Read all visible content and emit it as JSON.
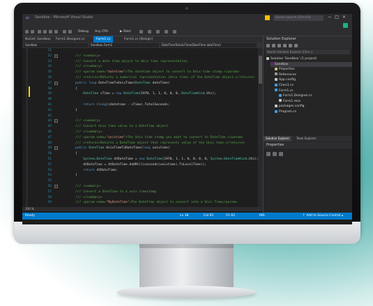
{
  "window": {
    "title": "Sandbox - Microsoft Visual Studio",
    "quick_launch_placeholder": "Quick Launch (Ctrl+Q)",
    "window_controls": [
      "−",
      "□",
      "×"
    ]
  },
  "menu": [
    "File",
    "Edit",
    "View",
    "Project",
    "Build",
    "Debug",
    "Team",
    "Tools",
    "Test",
    "Analyze",
    "Window",
    "Help"
  ],
  "toolbar": {
    "config": "Debug",
    "platform": "Any CPU",
    "start_label": "▶ Start"
  },
  "doc_tabs": [
    {
      "label": "NuGet: Sandbox",
      "active": false
    },
    {
      "label": "Form1.Designer.cs",
      "active": false
    },
    {
      "label": "Form1.cs",
      "active": true
    },
    {
      "label": "Form1.cs [Design]",
      "active": false
    }
  ],
  "navbar": {
    "project": "Sandbox",
    "class": "Sandbox.Form1",
    "member": "DateTimeToUnixTime(DateTime dateTime)"
  },
  "code_lines": [
    {
      "n": "31",
      "text": ""
    },
    {
      "n": "32",
      "text": "/// <summary>",
      "kind": "com"
    },
    {
      "n": "33",
      "text": "/// Convert a date time object to Unix time representation.",
      "kind": "com"
    },
    {
      "n": "34",
      "text": "/// </summary>",
      "kind": "com"
    },
    {
      "n": "35",
      "text": "/// <param name=\"datetime\">The datetime object to convert to Unix time stamp.</param>",
      "kind": "com"
    },
    {
      "n": "36",
      "text": "/// <returns>Returns a numerical representation (Unix time) of the DateTime object.</returns>",
      "kind": "com"
    },
    {
      "n": "37",
      "text": "public long DateTimeToUnixTime(DateTime dateTime)",
      "kind": "decl"
    },
    {
      "n": "38",
      "text": "{"
    },
    {
      "n": "39",
      "text": "    DateTime sTime = new DateTime(1970, 1, 1, 0, 0, 0, DateTimeKind.Utc);"
    },
    {
      "n": "40",
      "text": ""
    },
    {
      "n": "41",
      "text": "    return (long)(datetime - sTime).TotalSeconds;"
    },
    {
      "n": "42",
      "text": "}"
    },
    {
      "n": "43",
      "text": ""
    },
    {
      "n": "44",
      "text": "/// <summary>",
      "kind": "com"
    },
    {
      "n": "45",
      "text": "/// Convert Unix time value to a DateTime object.",
      "kind": "com"
    },
    {
      "n": "46",
      "text": "/// </summary>",
      "kind": "com"
    },
    {
      "n": "47",
      "text": "/// <param name=\"unixtime\">The Unix time stamp you want to convert to DateTime.</param>",
      "kind": "com"
    },
    {
      "n": "48",
      "text": "/// <returns>Returns a DateTime object that represents value of the Unix time.</returns>",
      "kind": "com"
    },
    {
      "n": "49",
      "text": "public DateTime UnixTimeToDateTime(long unixtime)",
      "kind": "decl"
    },
    {
      "n": "50",
      "text": "{"
    },
    {
      "n": "51",
      "text": "    System.DateTime dtDateTime = new DateTime(1970, 1, 1, 0, 0, 0, 0, System.DateTimeKind.Utc);"
    },
    {
      "n": "52",
      "text": "    dtDateTime = dtDateTime.AddMilliseconds(unixtime).ToLocalTime();"
    },
    {
      "n": "53",
      "text": "    return dtDateTime;"
    },
    {
      "n": "54",
      "text": "}"
    },
    {
      "n": "55",
      "text": ""
    },
    {
      "n": "56",
      "text": "/// <summary>",
      "kind": "com"
    },
    {
      "n": "57",
      "text": "/// Convert a DateTime to a unix timestamp",
      "kind": "com"
    },
    {
      "n": "58",
      "text": "/// </summary>",
      "kind": "com"
    },
    {
      "n": "59",
      "text": "/// <param name=\"MyDateTime\">The DateTime object to convert into a Unix Time</param>",
      "kind": "com"
    }
  ],
  "zoom": "100 %",
  "solution_explorer": {
    "title": "Solution Explorer",
    "search_placeholder": "Search Solution Explorer (Ctrl+;)",
    "items": [
      {
        "label": "Solution 'Sandbox' (1 project)",
        "depth": 0,
        "color": "#c5c5c5"
      },
      {
        "label": "Sandbox",
        "depth": 1,
        "color": "#68217a",
        "selected": true
      },
      {
        "label": "Properties",
        "depth": 2,
        "color": "#d7ba7d"
      },
      {
        "label": "References",
        "depth": 2,
        "color": "#9a9a9a"
      },
      {
        "label": "App.config",
        "depth": 2,
        "color": "#c5c5c5"
      },
      {
        "label": "Class1.cs",
        "depth": 2,
        "color": "#3aa0f3"
      },
      {
        "label": "Form1.cs",
        "depth": 2,
        "color": "#3aa0f3"
      },
      {
        "label": "Form1.Designer.cs",
        "depth": 3,
        "color": "#3aa0f3"
      },
      {
        "label": "Form1.resx",
        "depth": 3,
        "color": "#c5c5c5"
      },
      {
        "label": "packages.config",
        "depth": 2,
        "color": "#c5c5c5"
      },
      {
        "label": "Program.cs",
        "depth": 2,
        "color": "#3aa0f3"
      }
    ],
    "bottom_tabs": [
      "Solution Explorer",
      "Team Explorer"
    ]
  },
  "properties": {
    "title": "Properties"
  },
  "status_bar": {
    "left": "Ready",
    "ln": "Ln 38",
    "col": "Col 65",
    "ch": "Ch 62",
    "mode": "INS",
    "right": "↑ Add to Source Control ▴"
  },
  "colors": {
    "accent": "#007acc",
    "background": "#1e1e1e",
    "comment": "#57a64a",
    "keyword": "#569cd6",
    "type": "#4ec9b0"
  }
}
